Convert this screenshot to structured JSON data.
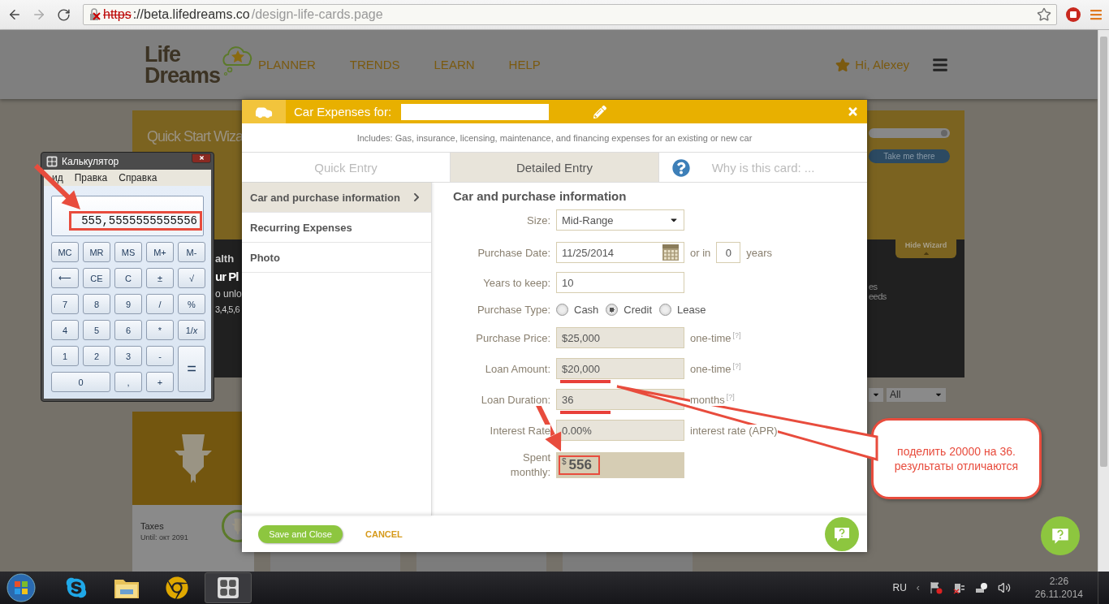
{
  "browser": {
    "url": {
      "scheme": "https",
      "host": "://beta.lifedreams.co",
      "path": "/design-life-cards.page",
      "insecure": true
    }
  },
  "site": {
    "logo": [
      "Life",
      "Dreams"
    ],
    "nav": [
      "PLANNER",
      "TRENDS",
      "LEARN",
      "HELP"
    ],
    "greeting": "Hi, Alexey"
  },
  "wizard": {
    "title": "Quick Start Wiza",
    "button": "Take me there",
    "hide": "Hide Wizard"
  },
  "dashboard": {
    "left_lines": [
      "alth",
      "ur Pl",
      "o unlo",
      "3,4,5,6"
    ],
    "right_lines": [
      "es",
      "eeds"
    ]
  },
  "filters": [
    "All"
  ],
  "cards": [
    {
      "title": "Taxes",
      "until": "Until: окт 2091"
    }
  ],
  "modal": {
    "title": "Car Expenses for:",
    "description": "Includes: Gas, insurance, licensing, maintenance, and financing expenses for an existing or new car",
    "tabs": [
      {
        "label": "Quick Entry",
        "selected": false,
        "kind": "plain"
      },
      {
        "label": "Detailed Entry",
        "selected": true,
        "kind": "plain"
      },
      {
        "label": "Why is this card: ...",
        "selected": false,
        "kind": "help"
      }
    ],
    "sections": [
      {
        "label": "Car and purchase information",
        "selected": true
      },
      {
        "label": "Recurring Expenses",
        "selected": false
      },
      {
        "label": "Photo",
        "selected": false
      }
    ],
    "form_title": "Car and purchase information",
    "fields": [
      {
        "kind": "select",
        "label": "Size:",
        "value": "Mid-Range"
      },
      {
        "kind": "date",
        "label": "Purchase Date:",
        "value": "11/25/2014",
        "connector": "or in",
        "years": "0",
        "unit": "years"
      },
      {
        "kind": "text",
        "label": "Years to keep:",
        "value": "10"
      },
      {
        "kind": "radio",
        "label": "Purchase Type:",
        "options": [
          {
            "label": "Cash",
            "selected": false
          },
          {
            "label": "Credit",
            "selected": true
          },
          {
            "label": "Lease",
            "selected": false
          }
        ]
      },
      {
        "kind": "readonly",
        "label": "Purchase Price:",
        "value": "$25,000",
        "suffix": "one-time",
        "hint": "[?]"
      },
      {
        "kind": "readonly",
        "label": "Loan Amount:",
        "value": "$20,000",
        "suffix": "one-time",
        "hint": "[?]",
        "underlined": true
      },
      {
        "kind": "readonly",
        "label": "Loan Duration:",
        "value": "36",
        "suffix": "months",
        "hint": "[?]",
        "underlined": true
      },
      {
        "kind": "readonly",
        "label": "Interest Rate",
        "value": "0.00%",
        "suffix": "interest rate (APR)"
      },
      {
        "kind": "result",
        "label": "Spent monthly:",
        "currency": "$",
        "value": "556",
        "highlighted": true
      }
    ],
    "save": "Save and Close",
    "cancel": "CANCEL"
  },
  "calculator": {
    "title": "Калькулятор",
    "menu": [
      "ид",
      "Правка",
      "Справка"
    ],
    "display": "555,5555555555556",
    "highlighted": true,
    "keys": [
      {
        "label": "MC",
        "kind": "normal"
      },
      {
        "label": "MR",
        "kind": "normal"
      },
      {
        "label": "MS",
        "kind": "normal"
      },
      {
        "label": "M+",
        "kind": "normal"
      },
      {
        "label": "M-",
        "kind": "normal"
      },
      {
        "label": "⟵",
        "kind": "normal"
      },
      {
        "label": "CE",
        "kind": "normal"
      },
      {
        "label": "C",
        "kind": "normal"
      },
      {
        "label": "±",
        "kind": "normal"
      },
      {
        "label": "√",
        "kind": "normal"
      },
      {
        "label": "7",
        "kind": "normal"
      },
      {
        "label": "8",
        "kind": "normal"
      },
      {
        "label": "9",
        "kind": "normal"
      },
      {
        "label": "/",
        "kind": "normal"
      },
      {
        "label": "%",
        "kind": "normal"
      },
      {
        "label": "4",
        "kind": "normal"
      },
      {
        "label": "5",
        "kind": "normal"
      },
      {
        "label": "6",
        "kind": "normal"
      },
      {
        "label": "*",
        "kind": "normal"
      },
      {
        "label": "1/*x*",
        "kind": "normal"
      },
      {
        "label": "1",
        "kind": "normal"
      },
      {
        "label": "2",
        "kind": "normal"
      },
      {
        "label": "3",
        "kind": "normal"
      },
      {
        "label": "-",
        "kind": "normal"
      },
      {
        "label": "=",
        "kind": "tall"
      },
      {
        "label": "0",
        "kind": "wide"
      },
      {
        "label": ",",
        "kind": "normal"
      },
      {
        "label": "+",
        "kind": "normal"
      }
    ]
  },
  "annotation": {
    "callout": [
      "поделить 20000 на 36.",
      "результаты отличаются"
    ]
  },
  "taskbar": {
    "apps": [
      {
        "kind": "skype",
        "active": false
      },
      {
        "kind": "folder",
        "active": false
      },
      {
        "kind": "chrome",
        "active": false
      },
      {
        "kind": "calculator",
        "active": true
      }
    ],
    "language": "RU",
    "tray_chevron": "‹",
    "time": "2:26",
    "date": "26.11.2014"
  }
}
